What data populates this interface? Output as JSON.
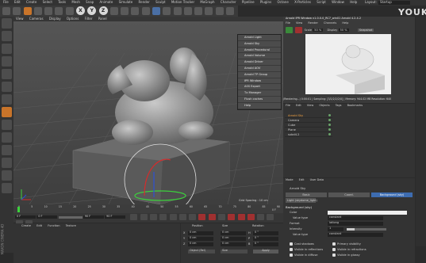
{
  "app_menu": [
    "File",
    "Edit",
    "Create",
    "Select",
    "Tools",
    "Mesh",
    "Snap",
    "Animate",
    "Simulate",
    "Render",
    "Sculpt",
    "Motion Tracker",
    "MoGraph",
    "Character",
    "Pipeline",
    "Plugins",
    "Octane",
    "X-Particles",
    "Script",
    "Window",
    "Help"
  ],
  "layout": {
    "label": "Layout:",
    "value": "Startup"
  },
  "watermark": "YOUKU",
  "toolbar": {
    "xyz": [
      "X",
      "Y",
      "Z"
    ]
  },
  "viewport": {
    "menu": [
      "View",
      "Cameras",
      "Display",
      "Options",
      "Filter",
      "Panel"
    ],
    "title": "Perspective",
    "grid_spacing": "Grid Spacing : 10 cm",
    "axis": {
      "x": "x",
      "y": "y",
      "z": "z"
    }
  },
  "arnold_menu": {
    "items": [
      "Arnold Light",
      "Arnold Sky",
      "Arnold Procedural",
      "Arnold Volume",
      "Arnold Driver",
      "Arnold AOV",
      "Arnold TP Group",
      "IPR Window",
      "ASS Export",
      "Tx Manager",
      "Flush caches",
      "Help"
    ]
  },
  "ipr": {
    "title": "Arnold IPR Window v1.0.0.0_RC7_win01 Arnold 4.2.4.2",
    "menu": [
      "File",
      "View",
      "Render",
      "Channels",
      "Help"
    ],
    "scale": "Scale",
    "scale_value": "50 %",
    "display": "Display",
    "display_value": "50 %",
    "snapshot": "Snapshot",
    "status": "(Rendering...)   0:00:01  |  Sampling: [3/2/2/2/2/0]  |  Memory: 944.02 MB  Resolution: 640"
  },
  "objects": {
    "menu": [
      "File",
      "Edit",
      "View",
      "Objects",
      "Tags",
      "Bookmarks"
    ],
    "rows": [
      "Arnold Sky",
      "Camera",
      "Cube",
      "Plane",
      "subd4.2"
    ]
  },
  "attributes": {
    "menu": [
      "Mode",
      "Edit",
      "User Data"
    ],
    "object": "Arnold Sky",
    "tabs": [
      "Basic",
      "Coord.",
      "Background (sky)"
    ],
    "subtab": "Light (skydome_light)",
    "section": "Background (sky)",
    "color_label": "Color",
    "value_type_label": "Value type",
    "value_type": "constant",
    "format_label": "Format",
    "format": "latlong",
    "intensity_label": "Intensity",
    "intensity_value": "1",
    "value_type2": "constant",
    "cast_shadows": "Cast shadows",
    "visible_reflections": "Visible in reflections",
    "visible_diffuse": "Visible in diffuse",
    "primary_visibility": "Primary visibility",
    "visible_refractions": "Visible in refractions",
    "visible_glossy": "Visible in glossy"
  },
  "timeline": {
    "ticks": [
      "0",
      "5",
      "10",
      "15",
      "20",
      "25",
      "30",
      "35",
      "40",
      "45",
      "50",
      "55",
      "60",
      "65",
      "70",
      "75",
      "80",
      "85",
      "90"
    ],
    "frame_start": "0 F",
    "frame_current": "0 F",
    "frame_end": "90 F",
    "frame_end2": "90 F",
    "frame_indicator": "0 F"
  },
  "materials": {
    "menu": [
      "Create",
      "Edit",
      "Function",
      "Texture"
    ]
  },
  "coords": {
    "headers": [
      "Position",
      "Size",
      "Rotation"
    ],
    "rows": [
      {
        "axis": "X",
        "pos": "0 cm",
        "size": "0 cm",
        "rot_label": "H",
        "rot": "0 °"
      },
      {
        "axis": "Y",
        "pos": "0 cm",
        "size": "0 cm",
        "rot_label": "P",
        "rot": "0 °"
      },
      {
        "axis": "Z",
        "pos": "0 cm",
        "size": "0 cm",
        "rot_label": "B",
        "rot": "0 °"
      }
    ],
    "mode": "Object (Rel)",
    "size_mode": "Size",
    "apply": "Apply"
  },
  "brand": "MAXON CINEMA 4D",
  "colors": {
    "accent": "#c8742a",
    "selection": "#e08a2a",
    "panel": "#3a3a3a"
  }
}
